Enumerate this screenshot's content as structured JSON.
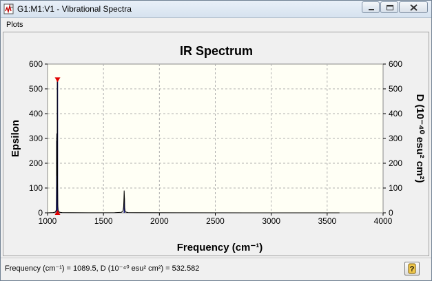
{
  "window": {
    "title": "G1:M1:V1 - Vibrational Spectra"
  },
  "menu": {
    "items": [
      "Plots"
    ]
  },
  "chart_data": {
    "type": "line",
    "title": "IR Spectrum",
    "xlabel": "Frequency (cm⁻¹)",
    "ylabel_left": "Epsilon",
    "ylabel_right": "D (10⁻⁴⁰ esu² cm²)",
    "xlim": [
      1000,
      4000
    ],
    "ylim": [
      0,
      600
    ],
    "x_ticks": [
      "1000",
      "1500",
      "2000",
      "2500",
      "3000",
      "3500",
      "4000"
    ],
    "y_ticks": [
      "0",
      "100",
      "200",
      "300",
      "400",
      "500",
      "600"
    ],
    "grid": true,
    "series": [
      {
        "x": [
          1000,
          1050,
          1070,
          1078,
          1080,
          1082,
          1084,
          1085,
          1086,
          1087,
          1088,
          1089.5,
          1091,
          1092,
          1093,
          1095,
          1098,
          1102,
          1110,
          1130,
          1200,
          1400,
          1600,
          1660,
          1675,
          1680,
          1683,
          1685,
          1688,
          1690,
          1693,
          1700,
          1720,
          1800,
          2200,
          2800,
          3300,
          3610
        ],
        "y": [
          0,
          1,
          3,
          12,
          120,
          290,
          320,
          150,
          300,
          535,
          300,
          120,
          60,
          35,
          22,
          12,
          7,
          4,
          2,
          1,
          0.5,
          0.3,
          0.5,
          2,
          8,
          25,
          60,
          90,
          55,
          20,
          8,
          3,
          1,
          0.5,
          0.2,
          0.1,
          0.1,
          0
        ]
      }
    ],
    "sticks": [
      {
        "x": 1082,
        "y": 290
      },
      {
        "x": 1084,
        "y": 320
      },
      {
        "x": 1089.5,
        "y": 535
      },
      {
        "x": 1686,
        "y": 60
      }
    ],
    "marker": {
      "x": 1089.5,
      "y": 535
    },
    "colors": {
      "plot_bg": "#fffff5",
      "line": "#000000",
      "stick": "#1a1a80",
      "marker": "#e00000",
      "grid": "#b0b0b0"
    }
  },
  "status": {
    "readout": "Frequency (cm⁻¹) = 1089.5, D (10⁻⁴⁰ esu² cm²) = 532.582"
  },
  "icons": {
    "app": "spectrum-app-icon",
    "help": "help-icon"
  }
}
